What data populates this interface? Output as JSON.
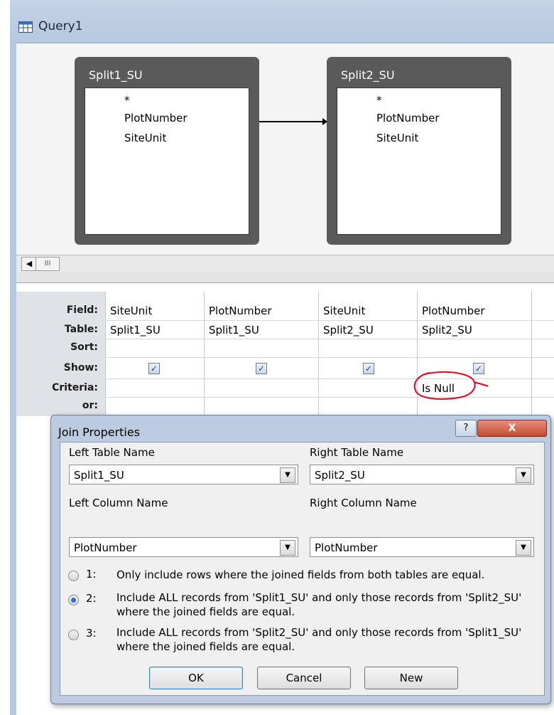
{
  "window": {
    "title": "Query1"
  },
  "tables": [
    {
      "name": "Split1_SU",
      "fields": [
        "*",
        "PlotNumber",
        "SiteUnit"
      ]
    },
    {
      "name": "Split2_SU",
      "fields": [
        "*",
        "PlotNumber",
        "SiteUnit"
      ]
    }
  ],
  "grid": {
    "row_labels": [
      "Field:",
      "Table:",
      "Sort:",
      "Show:",
      "Criteria:",
      "or:"
    ],
    "columns": [
      {
        "field": "SiteUnit",
        "table": "Split1_SU",
        "show": true,
        "criteria": ""
      },
      {
        "field": "PlotNumber",
        "table": "Split1_SU",
        "show": true,
        "criteria": ""
      },
      {
        "field": "SiteUnit",
        "table": "Split2_SU",
        "show": true,
        "criteria": ""
      },
      {
        "field": "PlotNumber",
        "table": "Split2_SU",
        "show": true,
        "criteria": "Is Null"
      }
    ]
  },
  "dialog": {
    "title": "Join Properties",
    "help_label": "?",
    "close_label": "X",
    "left_table_label": "Left Table Name",
    "left_table_value": "Split1_SU",
    "right_table_label": "Right Table Name",
    "right_table_value": "Split2_SU",
    "left_column_label": "Left Column Name",
    "left_column_value": "PlotNumber",
    "right_column_label": "Right Column Name",
    "right_column_value": "PlotNumber",
    "options": [
      {
        "num": "1:",
        "text": "Only include rows where the joined fields from both tables are equal.",
        "selected": false
      },
      {
        "num": "2:",
        "text": "Include ALL records from 'Split1_SU' and only those records from 'Split2_SU' where the joined fields are equal.",
        "selected": true
      },
      {
        "num": "3:",
        "text": "Include ALL records from 'Split2_SU' and only those records from 'Split1_SU' where the joined fields are equal.",
        "selected": false
      }
    ],
    "ok_label": "OK",
    "cancel_label": "Cancel",
    "new_label": "New"
  },
  "colors": {
    "annotation": "#e8001c",
    "dialog_frame": "#bccbe0",
    "close_button": "#c24a30"
  }
}
